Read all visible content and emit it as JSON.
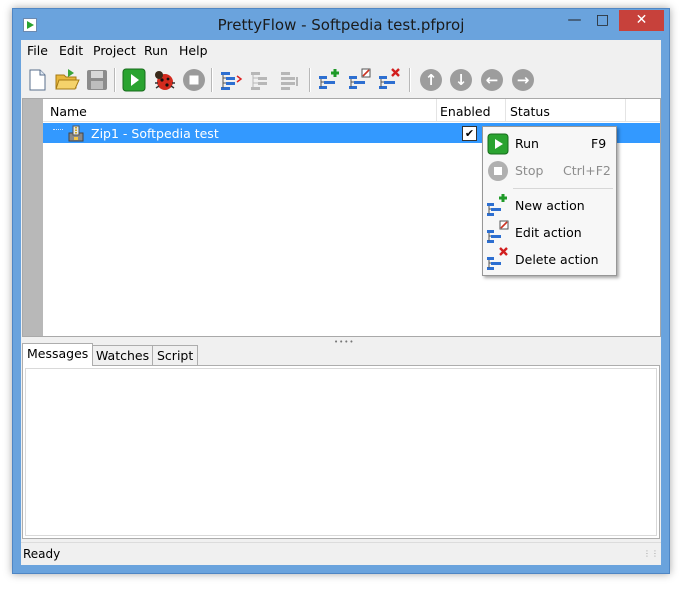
{
  "window": {
    "title": "PrettyFlow - Softpedia test.pfproj",
    "min": "—",
    "max": "□",
    "close": "✕"
  },
  "menu": [
    "File",
    "Edit",
    "Project",
    "Run",
    "Help"
  ],
  "toolbar": {
    "icons": [
      "new-file-icon",
      "open-folder-icon",
      "save-icon",
      "run-icon",
      "debug-bug-icon",
      "stop-icon",
      "action-tree-icon",
      "action-tree-disabled-icon",
      "action-tree-disabled-2-icon",
      "new-action-icon",
      "edit-action-icon",
      "delete-action-icon",
      "move-up-icon",
      "move-down-icon",
      "move-left-icon",
      "move-right-icon"
    ]
  },
  "grid": {
    "columns": [
      "Name",
      "Enabled",
      "Status"
    ],
    "rows": [
      {
        "name": "Zip1 - Softpedia test",
        "enabled": true,
        "status": ""
      }
    ]
  },
  "tabs": [
    "Messages",
    "Watches",
    "Script"
  ],
  "active_tab": "Messages",
  "status": "Ready",
  "context_menu": {
    "items": [
      {
        "label": "Run",
        "shortcut": "F9",
        "enabled": true,
        "icon": "run-icon"
      },
      {
        "label": "Stop",
        "shortcut": "Ctrl+F2",
        "enabled": false,
        "icon": "stop-icon"
      },
      {
        "label": "New action",
        "shortcut": "",
        "enabled": true,
        "icon": "new-action-icon"
      },
      {
        "label": "Edit action",
        "shortcut": "",
        "enabled": true,
        "icon": "edit-action-icon"
      },
      {
        "label": "Delete action",
        "shortcut": "",
        "enabled": true,
        "icon": "delete-action-icon"
      }
    ]
  },
  "colors": {
    "titlebar": "#6aa3dd",
    "selection": "#3399ff",
    "run_green": "#2aa330",
    "close_red": "#c7413b"
  }
}
